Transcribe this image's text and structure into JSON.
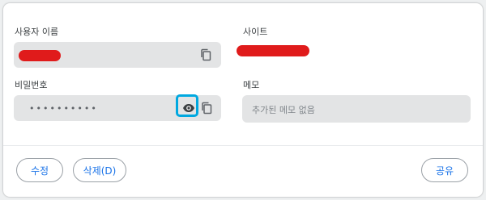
{
  "fields": {
    "username": {
      "label": "사용자 이름",
      "value": ""
    },
    "site": {
      "label": "사이트",
      "value": ""
    },
    "password": {
      "label": "비밀번호",
      "value": "••••••••••"
    },
    "memo": {
      "label": "메모",
      "placeholder": "추가된 메모 없음"
    }
  },
  "buttons": {
    "edit": "수정",
    "delete": "삭제(D)",
    "share": "공유"
  },
  "icons": {
    "copy": "copy-icon",
    "show_password": "eye-icon"
  },
  "colors": {
    "accent": "#1a73e8",
    "redaction": "#e01b1b",
    "highlight": "#00a8e0",
    "field_bg": "#e3e4e5"
  }
}
